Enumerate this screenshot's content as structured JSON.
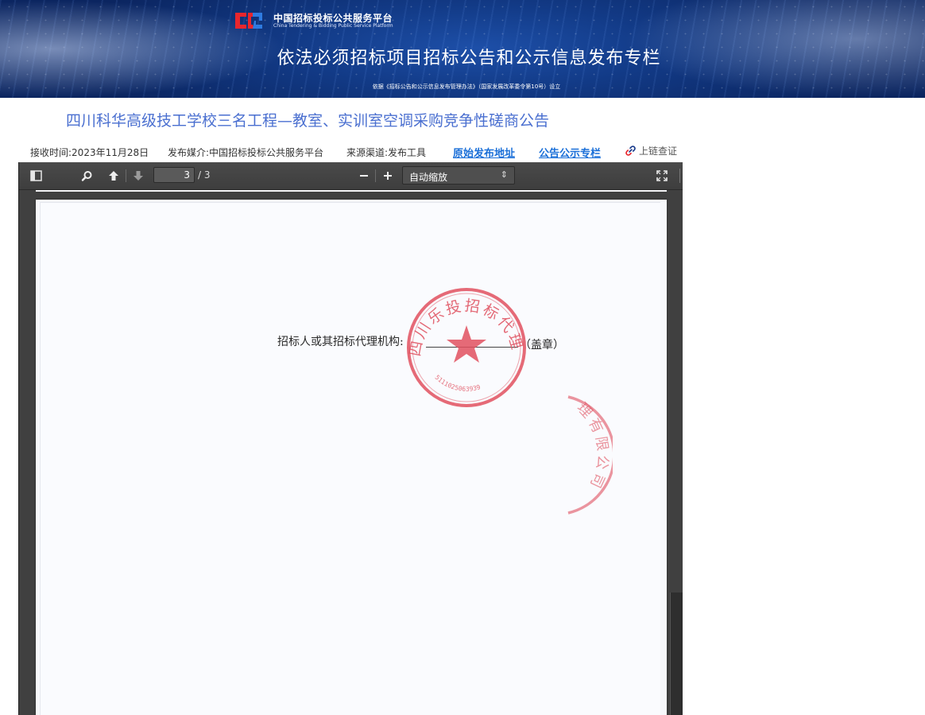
{
  "banner": {
    "platform_cn": "中国招标投标公共服务平台",
    "platform_en": "China Tendering & Bidding Public Service Platform",
    "title": "依法必须招标项目招标公告和公示信息发布专栏",
    "basis": "依据《招标公告和公示信息发布管理办法》（国家发展改革委令第10号）设立"
  },
  "announcement": {
    "title": "四川科华高级技工学校三名工程—教室、实训室空调采购竞争性磋商公告"
  },
  "meta": {
    "received": "接收时间:2023年11月28日",
    "media": "发布媒介:中国招标投标公共服务平台",
    "channel": "来源渠道:发布工具",
    "original_link": "原始发布地址",
    "notice_link": "公告公示专栏",
    "chain_verify": "上链查证"
  },
  "viewer": {
    "page_current": "3",
    "page_total": "/ 3",
    "zoom": "自动缩放",
    "zoom_options": [
      "自动缩放"
    ]
  },
  "document": {
    "signature_label": "招标人或其招标代理机构:",
    "signature_suffix": "（盖章）",
    "seal_main_text": "四川乐投招标代理有限公司",
    "seal_main_code": "5111025063939",
    "seal_partial_text": "理有限公司"
  },
  "colors": {
    "title_blue": "#4a6fd0",
    "link_blue": "#1a6fd8",
    "seal_red": "#e0505f",
    "banner_navy": "#123a86"
  },
  "icons": {
    "sidebar": "sidebar-toggle-icon",
    "search": "search-icon",
    "prev": "arrow-up-icon",
    "next": "arrow-down-icon",
    "zoom_out": "minus-icon",
    "zoom_in": "plus-icon",
    "fullscreen": "fullscreen-icon",
    "chain": "chain-link-icon"
  }
}
